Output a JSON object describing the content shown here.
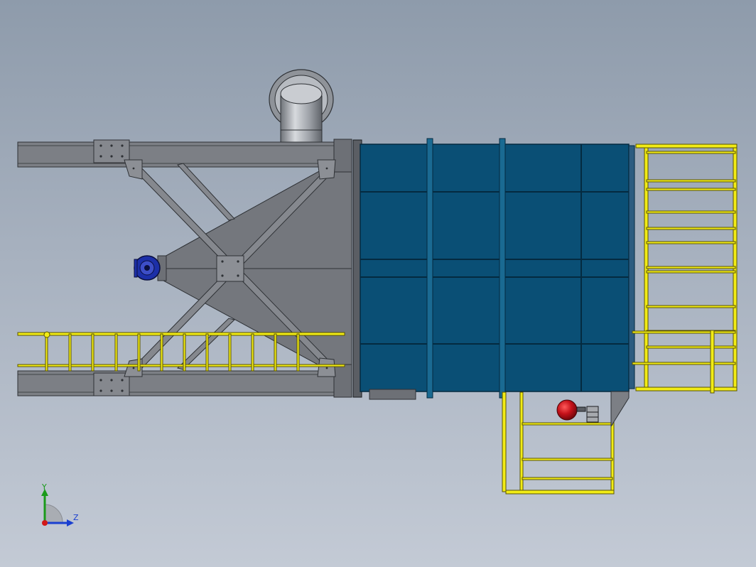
{
  "viewport": {
    "view": "cad-assembly-top-view",
    "colors": {
      "background_top": "#8e9bab",
      "background_bottom": "#c3cad5",
      "steel": "#7c7f85",
      "steel_edge": "#2e3135",
      "tank_blue": "#0a4f75",
      "railing_yellow": "#f2ec16",
      "flange_blue": "#1c2fa8",
      "sphere_red": "#c5121a",
      "duct_gray": "#a2a6ad"
    }
  },
  "triad": {
    "y_label": "Y",
    "z_label": "Z",
    "icon": "coordinate-triad-icon"
  }
}
